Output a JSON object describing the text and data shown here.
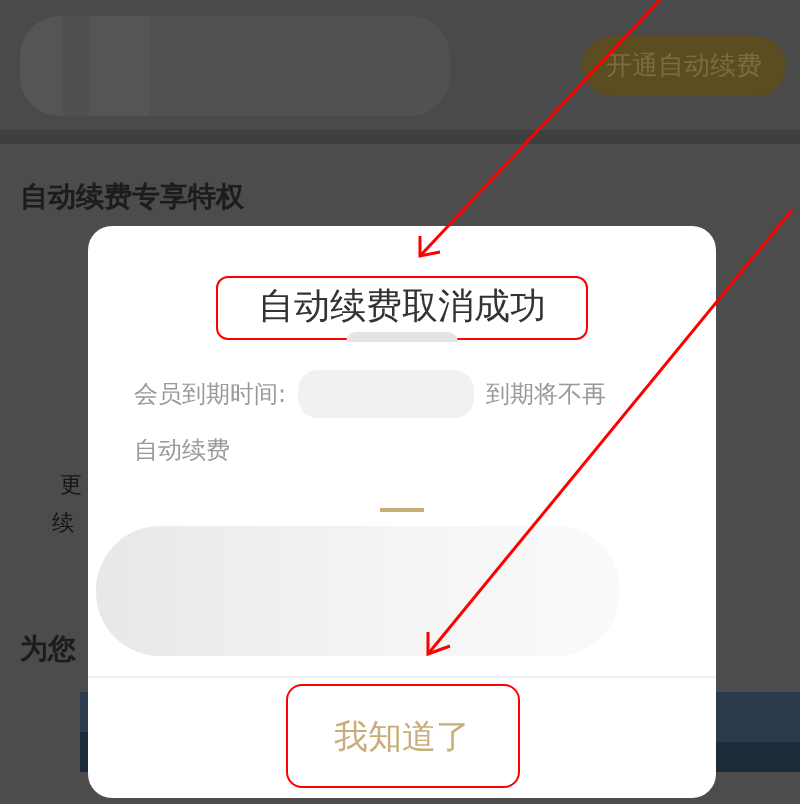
{
  "page": {
    "enable_button": "开通自动续费",
    "section_title": "自动续费专享特权",
    "partial_texts": [
      "更",
      "续"
    ],
    "section2_title": "为您"
  },
  "dialog": {
    "title": "自动续费取消成功",
    "expiry_label": "会员到期时间:",
    "expiry_note": "到期将不再",
    "expiry_note_cont": "自动续费",
    "confirm_button": "我知道了"
  }
}
